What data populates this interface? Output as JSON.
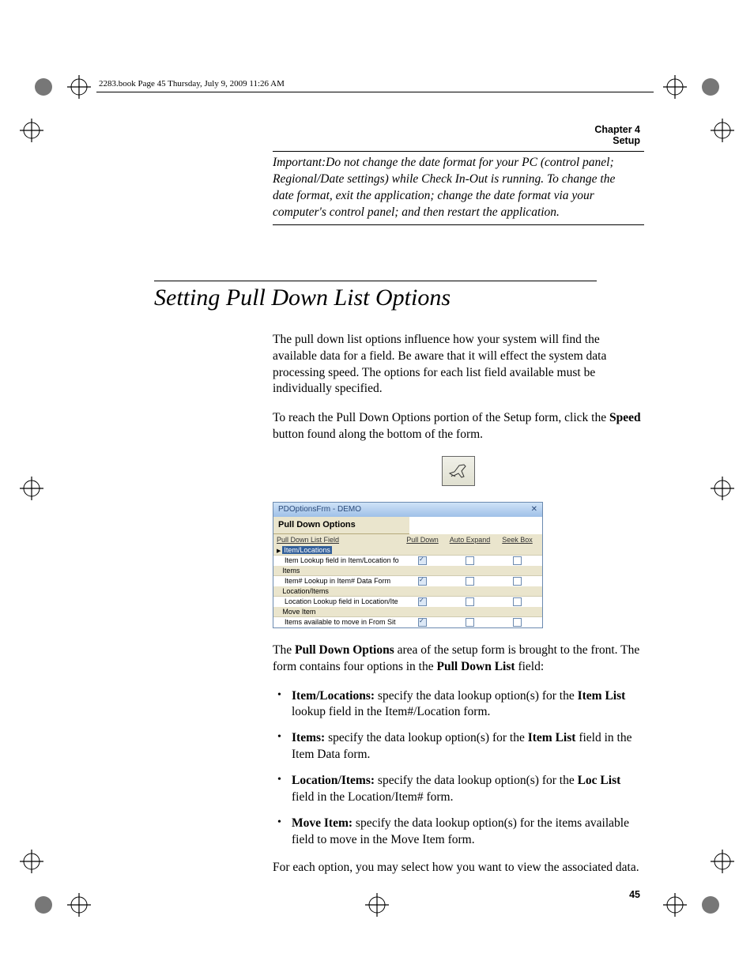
{
  "header": {
    "book_line": "2283.book  Page 45  Thursday, July 9, 2009  11:26 AM",
    "chapter": "Chapter 4",
    "chapter_title": "Setup"
  },
  "note": {
    "text": "Important:Do not change the date format for your PC (control panel; Regional/Date settings) while Check In-Out is running. To change the date format, exit the application; change the date format via your computer's control panel; and then restart the application."
  },
  "section": {
    "title": "Setting Pull Down List Options",
    "para1": "The pull down list options influence how your system will find the available data for a field. Be aware that it will effect the system data processing speed. The options for each list field available must be individually specified.",
    "para2a": "To reach the Pull Down Options portion of the Setup form, click the ",
    "para2b": "Speed",
    "para2c": " button found along the bottom of the form."
  },
  "window": {
    "title": "PDOptionsFrm - DEMO",
    "heading": "Pull Down Options",
    "columns": [
      "Pull Down List Field",
      "Pull Down",
      "Auto Expand",
      "Seek Box"
    ],
    "rows": [
      {
        "group": "Item/Locations",
        "selected": true,
        "detail": "Item Lookup field in Item/Location fo",
        "pulldown": true,
        "autoexpand": false,
        "seekbox": false
      },
      {
        "group": "Items",
        "selected": false,
        "detail": "Item# Lookup in Item# Data Form",
        "pulldown": true,
        "autoexpand": false,
        "seekbox": false
      },
      {
        "group": "Location/Items",
        "selected": false,
        "detail": "Location Lookup field in Location/Ite",
        "pulldown": true,
        "autoexpand": false,
        "seekbox": false
      },
      {
        "group": "Move Item",
        "selected": false,
        "detail": "Items available to move in From Sit",
        "pulldown": true,
        "autoexpand": false,
        "seekbox": false
      }
    ]
  },
  "after": {
    "para3a": "The ",
    "para3b": "Pull Down Options",
    "para3c": " area of the setup form is brought to the front. The form contains four options in the ",
    "para3d": "Pull Down List",
    "para3e": " field:",
    "bullets": [
      {
        "bold": "Item/Locations:",
        "text1": " specify the data lookup option(s) for the ",
        "bold2": "Item List",
        "text2": " lookup field in the Item#/Location form."
      },
      {
        "bold": "Items:",
        "text1": " specify the data lookup option(s) for the ",
        "bold2": "Item List",
        "text2": " field in the Item Data form."
      },
      {
        "bold": "Location/Items:",
        "text1": " specify the data lookup option(s) for the ",
        "bold2": "Loc List",
        "text2": " field in the Location/Item# form."
      },
      {
        "bold": "Move Item:",
        "text1": " specify the data lookup option(s) for the items available field to move in the Move Item form.",
        "bold2": "",
        "text2": ""
      }
    ],
    "para4": "For each option, you may select how you want to view the associated data."
  },
  "pagenum": "45"
}
